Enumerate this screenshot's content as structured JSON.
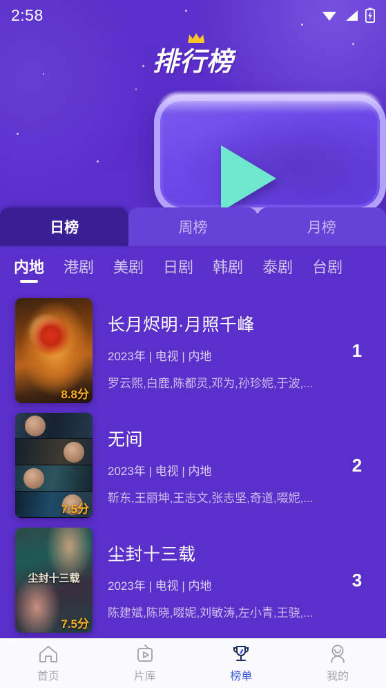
{
  "status_bar": {
    "time": "2:58",
    "icons": [
      "wifi-icon",
      "cellular-signal-icon",
      "battery-charging-icon"
    ]
  },
  "header": {
    "logo_text": "排行榜",
    "crown_icon": "crown-icon",
    "illustration": {
      "type": "tv-play-illustration",
      "play_icon": "play-triangle-icon",
      "play_color": "#6fe7cf",
      "screen_color": "#6b48e8"
    }
  },
  "period_tabs": [
    {
      "label": "日榜",
      "active": true
    },
    {
      "label": "周榜",
      "active": false
    },
    {
      "label": "月榜",
      "active": false
    }
  ],
  "category_tabs": [
    {
      "label": "内地",
      "active": true
    },
    {
      "label": "港剧",
      "active": false
    },
    {
      "label": "美剧",
      "active": false
    },
    {
      "label": "日剧",
      "active": false
    },
    {
      "label": "韩剧",
      "active": false
    },
    {
      "label": "泰剧",
      "active": false
    },
    {
      "label": "台剧",
      "active": false
    }
  ],
  "list": [
    {
      "rank": "1",
      "title": "长月烬明·月照千峰",
      "meta": "2023年 | 电视 | 内地",
      "cast": "罗云熙,白鹿,陈都灵,邓为,孙珍妮,于波,...",
      "score": "8.8分",
      "poster_title": ""
    },
    {
      "rank": "2",
      "title": "无间",
      "meta": "2023年 | 电视 | 内地",
      "cast": "靳东,王丽坤,王志文,张志坚,奇道,啜妮,...",
      "score": "7.5分",
      "poster_title": ""
    },
    {
      "rank": "3",
      "title": "尘封十三载",
      "meta": "2023年 | 电视 | 内地",
      "cast": "陈建斌,陈晓,啜妮,刘敏涛,左小青,王骁,...",
      "score": "7.5分",
      "poster_title": "尘封十三载"
    }
  ],
  "bottom_nav": [
    {
      "label": "首页",
      "icon": "home-icon",
      "active": false
    },
    {
      "label": "片库",
      "icon": "tv-icon",
      "active": false
    },
    {
      "label": "榜单",
      "icon": "trophy-icon",
      "active": true
    },
    {
      "label": "我的",
      "icon": "person-icon",
      "active": false
    }
  ],
  "colors": {
    "background": "#5b2fc9",
    "tab_active": "#3a1f94",
    "tab_inactive": "#6543d8",
    "score": "#ffb020",
    "nav_active": "#3a5bdb"
  }
}
